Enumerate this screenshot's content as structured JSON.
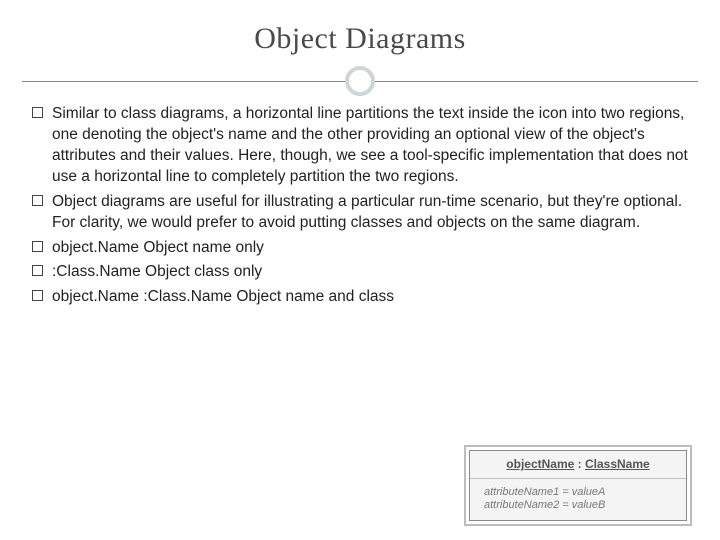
{
  "title": "Object Diagrams",
  "bullets": [
    "Similar to class diagrams, a horizontal line partitions the text inside the icon into two regions, one denoting the object's name and the other providing an optional view of the object's attributes and their values. Here, though, we see a tool-specific implementation that does not use a horizontal line to completely partition the two regions.",
    "Object diagrams are useful for illustrating a particular run-time scenario, but they're optional. For clarity, we would prefer to avoid putting classes and objects on the same diagram.",
    "object.Name Object name only",
    ":Class.Name Object class only",
    "object.Name :Class.Name Object name and class"
  ],
  "object_box": {
    "header_object": "objectName",
    "header_sep": " : ",
    "header_class": "ClassName",
    "attr1": "attributeName1 = valueA",
    "attr2": "attributeName2 = valueB"
  }
}
